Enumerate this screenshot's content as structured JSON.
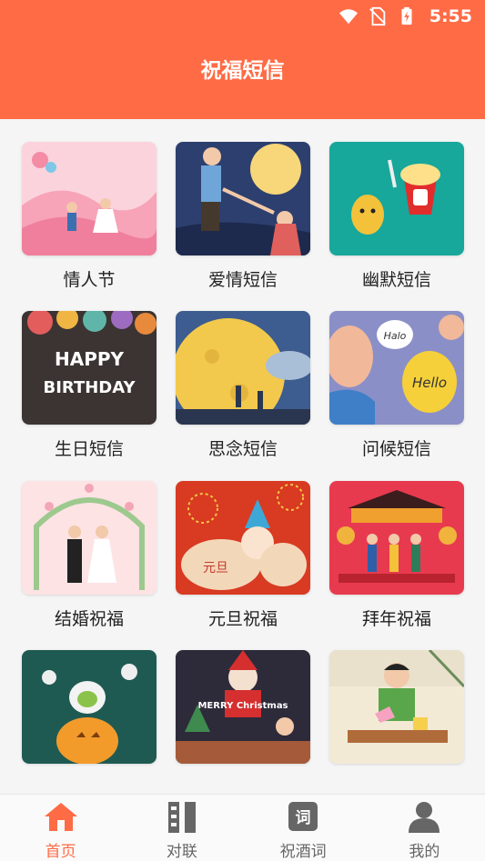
{
  "status_bar": {
    "time": "5:55",
    "icons": [
      "wifi-icon",
      "no-sim-icon",
      "battery-charging-icon"
    ]
  },
  "header": {
    "title": "祝福短信",
    "color": "#ff6b45"
  },
  "grid": {
    "items": [
      {
        "label": "情人节",
        "image": "valentines-illustration"
      },
      {
        "label": "爱情短信",
        "image": "love-illustration"
      },
      {
        "label": "幽默短信",
        "image": "humor-illustration"
      },
      {
        "label": "生日短信",
        "image": "birthday-illustration"
      },
      {
        "label": "思念短信",
        "image": "missing-illustration"
      },
      {
        "label": "问候短信",
        "image": "greeting-illustration"
      },
      {
        "label": "结婚祝福",
        "image": "wedding-illustration"
      },
      {
        "label": "元旦祝福",
        "image": "new-year-illustration"
      },
      {
        "label": "拜年祝福",
        "image": "spring-festival-illustration"
      },
      {
        "label": "",
        "image": "halloween-illustration"
      },
      {
        "label": "",
        "image": "christmas-illustration"
      },
      {
        "label": "",
        "image": "teacher-illustration"
      }
    ],
    "thumb_texts": {
      "birthday": "HAPPY BIRTHDAY",
      "greeting_1": "Halo",
      "greeting_2": "Hello",
      "new_year": "元旦",
      "christmas": "MERRY Christmas"
    }
  },
  "tabbar": {
    "active": 0,
    "tabs": [
      {
        "label": "首页",
        "icon": "home-icon"
      },
      {
        "label": "对联",
        "icon": "couplet-icon"
      },
      {
        "label": "祝酒词",
        "icon": "toast-words-icon"
      },
      {
        "label": "我的",
        "icon": "user-icon"
      }
    ],
    "toast_icon_glyph": "词",
    "active_color": "#ff6b45",
    "inactive_color": "#666666"
  }
}
